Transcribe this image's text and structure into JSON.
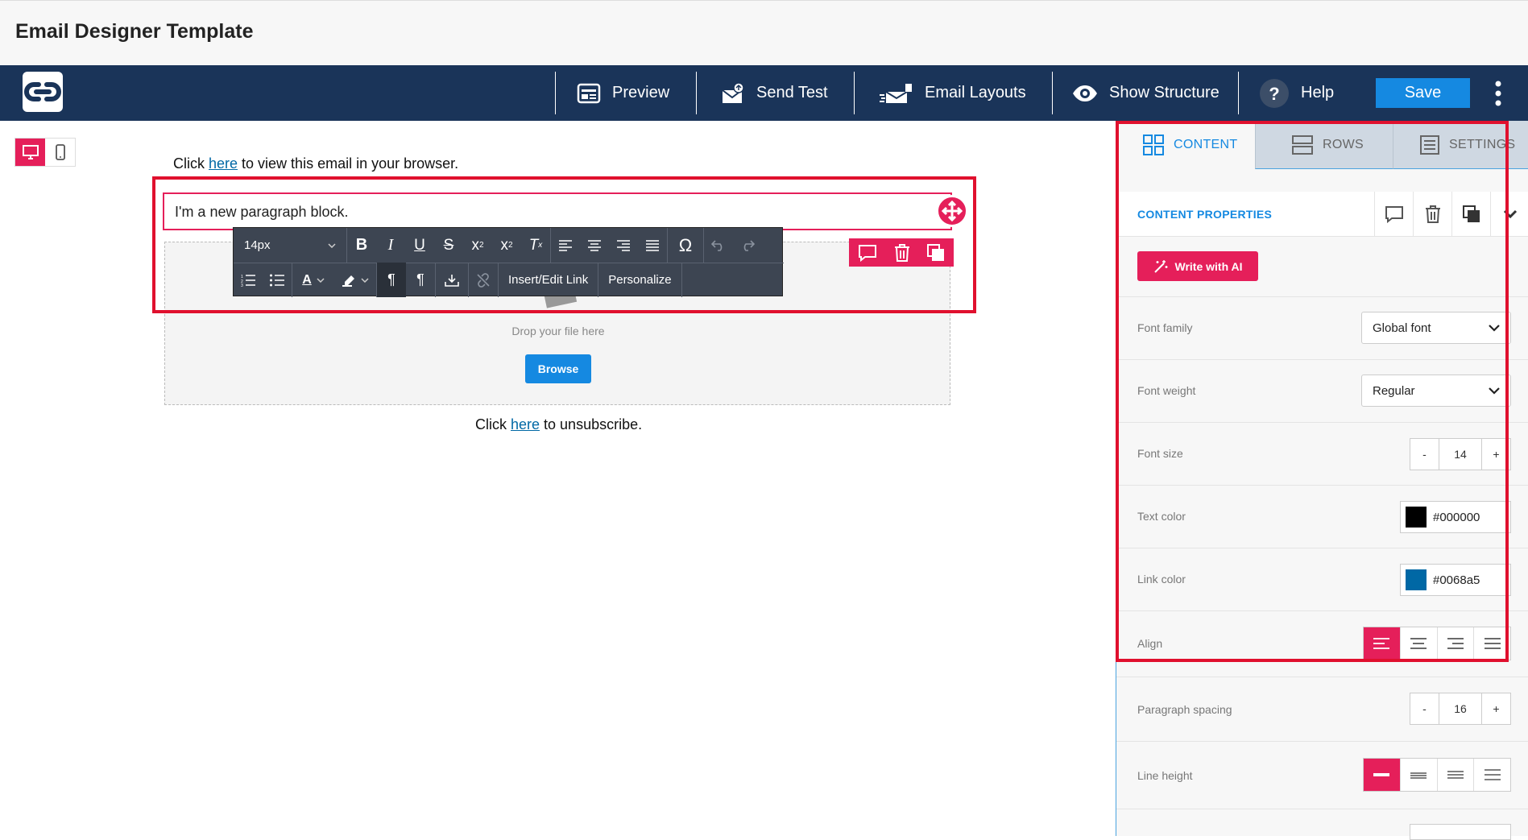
{
  "window": {
    "title": "Email Designer Template"
  },
  "navbar": {
    "preview": "Preview",
    "send_test": "Send Test",
    "email_layouts": "Email Layouts",
    "show_structure": "Show Structure",
    "help": "Help",
    "save": "Save"
  },
  "email": {
    "view_prefix": "Click ",
    "view_link": "here",
    "view_suffix": " to view this email in your browser.",
    "paragraph": "I'm a new paragraph block.",
    "drop_label": "Drop your file here",
    "browse": "Browse",
    "unsub_prefix": "Click ",
    "unsub_link": "here",
    "unsub_suffix": " to unsubscribe."
  },
  "toolbar": {
    "font_size": "14px",
    "insert_link": "Insert/Edit Link",
    "personalize": "Personalize"
  },
  "panel": {
    "tabs": [
      {
        "label": "CONTENT"
      },
      {
        "label": "ROWS"
      },
      {
        "label": "SETTINGS"
      }
    ],
    "header": "CONTENT PROPERTIES",
    "write_ai": "Write with AI",
    "font_family": {
      "label": "Font family",
      "value": "Global font"
    },
    "font_weight": {
      "label": "Font weight",
      "value": "Regular"
    },
    "font_size": {
      "label": "Font size",
      "minus": "-",
      "value": "14",
      "plus": "+"
    },
    "text_color": {
      "label": "Text color",
      "value": "#000000"
    },
    "link_color": {
      "label": "Link color",
      "value": "#0068a5"
    },
    "align": {
      "label": "Align"
    },
    "paragraph_spacing": {
      "label": "Paragraph spacing",
      "minus": "-",
      "value": "16",
      "plus": "+"
    },
    "line_height": {
      "label": "Line height"
    }
  },
  "colors": {
    "navbar": "#1a3459",
    "accent": "#e51f5a",
    "primary": "#1589e1",
    "selection": "#e0102e"
  }
}
